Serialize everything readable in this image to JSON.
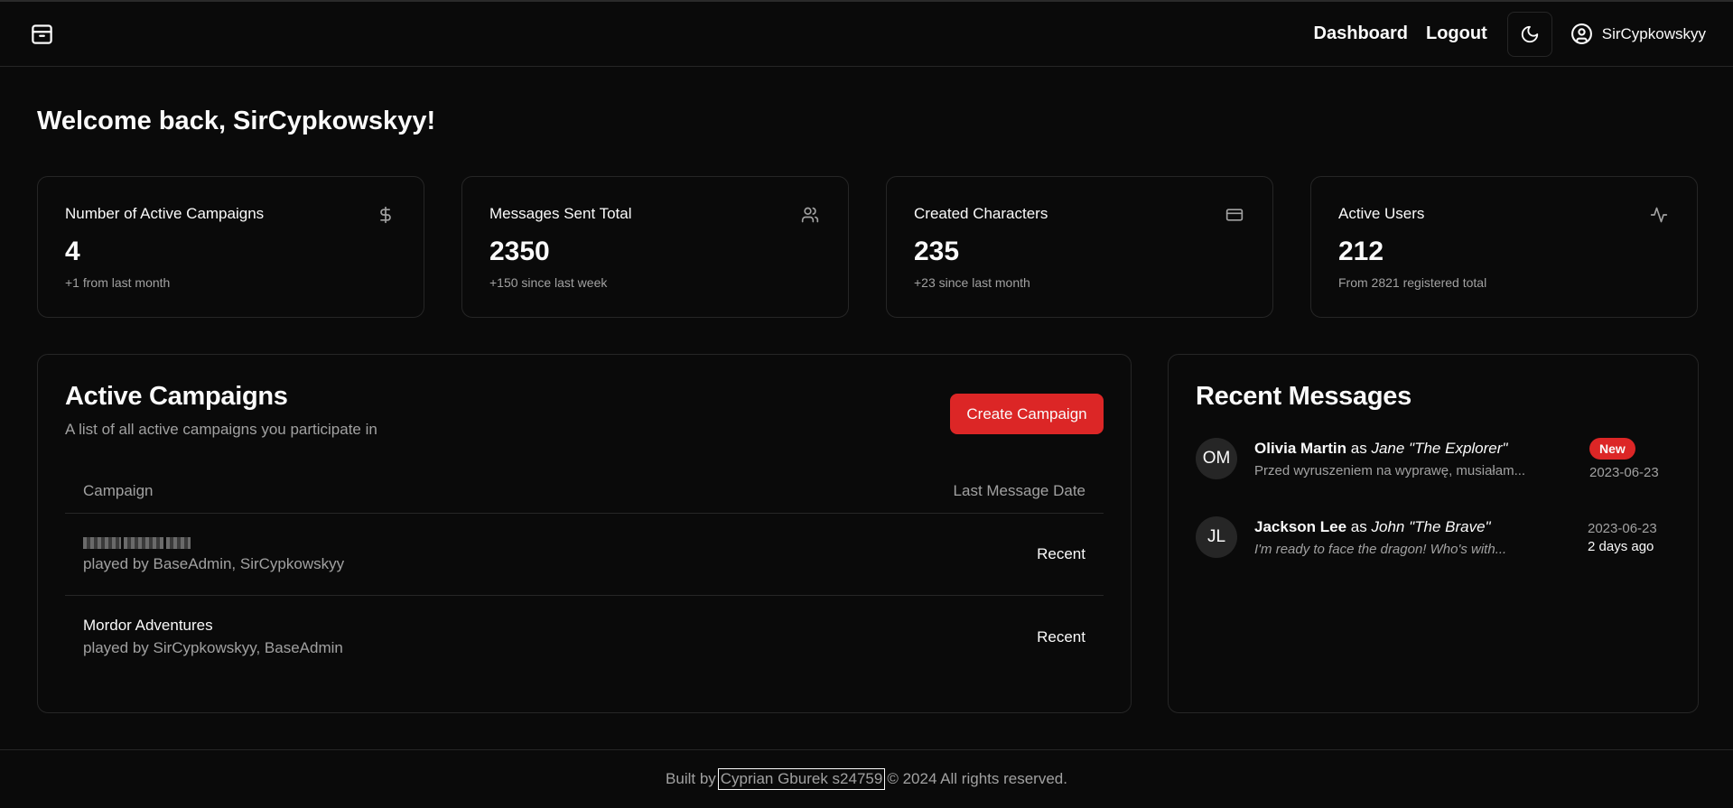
{
  "header": {
    "logo_icon": "box-icon",
    "nav": {
      "dashboard": "Dashboard",
      "logout": "Logout"
    },
    "theme_icon": "moon-icon",
    "user": {
      "icon": "user-circle-icon",
      "name": "SirCypkowskyy"
    }
  },
  "welcome": "Welcome back, SirCypkowskyy!",
  "stats": [
    {
      "title": "Number of Active Campaigns",
      "value": "4",
      "sub": "+1 from last month",
      "icon": "dollar-icon"
    },
    {
      "title": "Messages Sent Total",
      "value": "2350",
      "sub": "+150 since last week",
      "icon": "users-icon"
    },
    {
      "title": "Created Characters",
      "value": "235",
      "sub": "+23 since last month",
      "icon": "credit-card-icon"
    },
    {
      "title": "Active Users",
      "value": "212",
      "sub": "From 2821 registered total",
      "icon": "activity-icon"
    }
  ],
  "campaigns": {
    "title": "Active Campaigns",
    "description": "A list of all active campaigns you participate in",
    "create_label": "Create Campaign",
    "columns": {
      "campaign": "Campaign",
      "last_date": "Last Message Date"
    },
    "rows": [
      {
        "name": "",
        "players": "played by BaseAdmin, SirCypkowskyy",
        "date": "Recent"
      },
      {
        "name": "Mordor Adventures",
        "players": "played by SirCypkowskyy, BaseAdmin",
        "date": "Recent"
      }
    ]
  },
  "messages": {
    "title": "Recent Messages",
    "items": [
      {
        "initials": "OM",
        "author": "Olivia Martin",
        "as": "as",
        "character": "Jane \"The Explorer\"",
        "text": "Przed wyruszeniem na wyprawę, musiałam...",
        "badge": "New",
        "date": "2023-06-23",
        "ago": ""
      },
      {
        "initials": "JL",
        "author": "Jackson Lee",
        "as": "as",
        "character": "John \"The Brave\"",
        "text": "I'm ready to face the dragon! Who's with...",
        "badge": "",
        "date": "2023-06-23",
        "ago": "2 days ago"
      }
    ]
  },
  "footer": {
    "prefix": "Built by",
    "author": "Cyprian Gburek s24759",
    "suffix": "© 2024 All rights reserved."
  }
}
